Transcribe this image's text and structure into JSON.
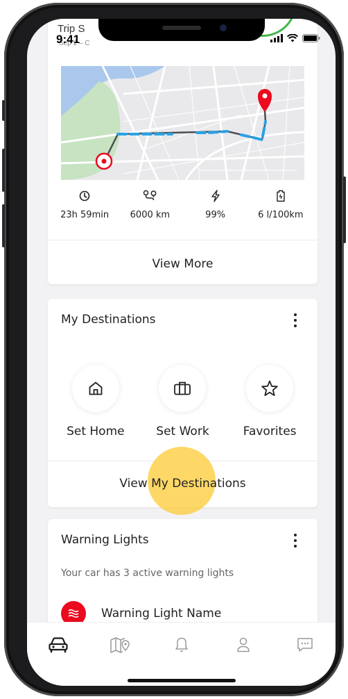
{
  "status_bar": {
    "time": "9:41"
  },
  "trip_header": {
    "title": "Trip S",
    "date": "Sep 2 – C"
  },
  "trip_card": {
    "stats": [
      {
        "icon": "clock-icon",
        "value": "23h 59min"
      },
      {
        "icon": "route-icon",
        "value": "6000 km"
      },
      {
        "icon": "lightning-icon",
        "value": "99%"
      },
      {
        "icon": "fuel-pump-icon",
        "value": "6 l/100km"
      }
    ],
    "view_more_label": "View More"
  },
  "destinations_card": {
    "title": "My Destinations",
    "items": [
      {
        "icon": "home-icon",
        "label": "Set Home"
      },
      {
        "icon": "briefcase-icon",
        "label": "Set Work"
      },
      {
        "icon": "star-icon",
        "label": "Favorites"
      }
    ],
    "footer_label": "View My Destinations"
  },
  "warning_card": {
    "title": "Warning Lights",
    "subtitle": "Your car has 3 active warning lights",
    "item_label": "Warning Light Name",
    "item_icon": "coolant-warning-icon"
  },
  "bottom_nav": [
    {
      "icon": "car-icon",
      "active": true
    },
    {
      "icon": "map-pin-icon",
      "active": false
    },
    {
      "icon": "bell-icon",
      "active": false
    },
    {
      "icon": "profile-icon",
      "active": false
    },
    {
      "icon": "chat-icon",
      "active": false
    }
  ],
  "colors": {
    "accent_red": "#eb0a1e",
    "route_blue": "#2aa2e6",
    "score_green": "#44b54a",
    "touch_yellow": "#fdcd3c",
    "map_water": "#a9c8ec",
    "map_park": "#c7e3c2"
  }
}
